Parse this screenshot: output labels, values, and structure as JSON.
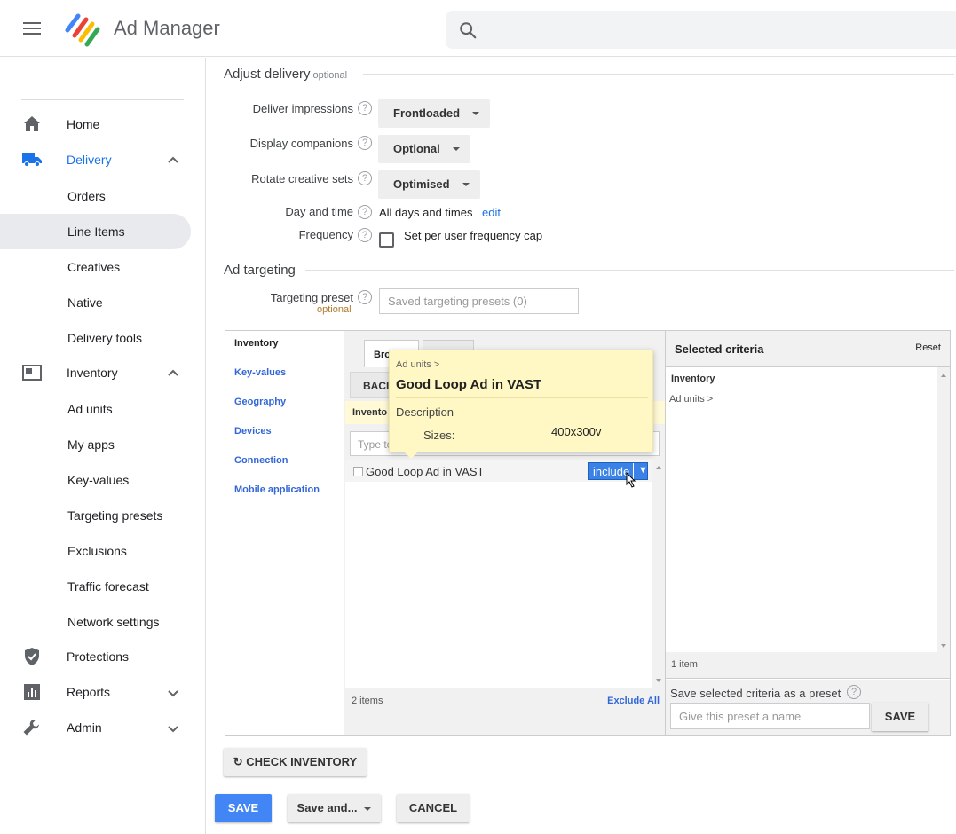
{
  "app": {
    "title": "Ad Manager"
  },
  "sidebar": {
    "items": [
      {
        "label": "Home",
        "icon": "home-icon"
      },
      {
        "label": "Delivery",
        "icon": "truck-icon"
      },
      {
        "label": "Orders"
      },
      {
        "label": "Line Items"
      },
      {
        "label": "Creatives"
      },
      {
        "label": "Native"
      },
      {
        "label": "Delivery tools"
      },
      {
        "label": "Inventory",
        "icon": "inventory-icon"
      },
      {
        "label": "Ad units"
      },
      {
        "label": "My apps"
      },
      {
        "label": "Key-values"
      },
      {
        "label": "Targeting presets"
      },
      {
        "label": "Exclusions"
      },
      {
        "label": "Traffic forecast"
      },
      {
        "label": "Network settings"
      },
      {
        "label": "Protections",
        "icon": "shield-icon"
      },
      {
        "label": "Reports",
        "icon": "bar-chart-icon"
      },
      {
        "label": "Admin",
        "icon": "wrench-icon"
      }
    ]
  },
  "adjust_delivery": {
    "title": "Adjust delivery",
    "optional": "optional",
    "deliver_impressions": {
      "label": "Deliver impressions",
      "value": "Frontloaded"
    },
    "display_companions": {
      "label": "Display companions",
      "value": "Optional"
    },
    "rotate_creative_sets": {
      "label": "Rotate creative sets",
      "value": "Optimised"
    },
    "day_and_time": {
      "label": "Day and time",
      "value": "All days and times",
      "edit": "edit"
    },
    "frequency": {
      "label": "Frequency",
      "checkbox_label": "Set per user frequency cap"
    }
  },
  "ad_targeting": {
    "title": "Ad targeting",
    "preset": {
      "label": "Targeting preset",
      "optional": "optional",
      "placeholder": "Saved targeting presets (0)"
    }
  },
  "targeting_widget": {
    "categories": [
      "Inventory",
      "Key-values",
      "Geography",
      "Devices",
      "Connection",
      "Mobile application"
    ],
    "tabs": [
      "Bro",
      ""
    ],
    "back_label": "BACI",
    "crumb": "Invento",
    "search_placeholder": "Type to",
    "results": [
      {
        "label": "Good Loop Ad in VAST",
        "action": "include",
        "arrow": "▼"
      }
    ],
    "items_count": "2 items",
    "exclude_all": "Exclude All",
    "selected": {
      "title": "Selected criteria",
      "reset": "Reset",
      "section": "Inventory",
      "item": "Ad units >",
      "count": "1 item",
      "preset_label": "Save selected criteria as a preset",
      "preset_placeholder": "Give this preset a name",
      "save": "SAVE"
    },
    "tooltip": {
      "crumb": "Ad units >",
      "title": "Good Loop Ad in VAST",
      "desc": "Description",
      "sizes_label": "Sizes:",
      "sizes_value": "400x300v"
    }
  },
  "check_inventory": "↻ CHECK INVENTORY",
  "footer": {
    "save": "SAVE",
    "save_and": "Save and...",
    "cancel": "CANCEL"
  },
  "colors": {
    "accent": "#1a73e8",
    "button_blue": "#4285f4",
    "tooltip_bg": "#fff8c4"
  }
}
